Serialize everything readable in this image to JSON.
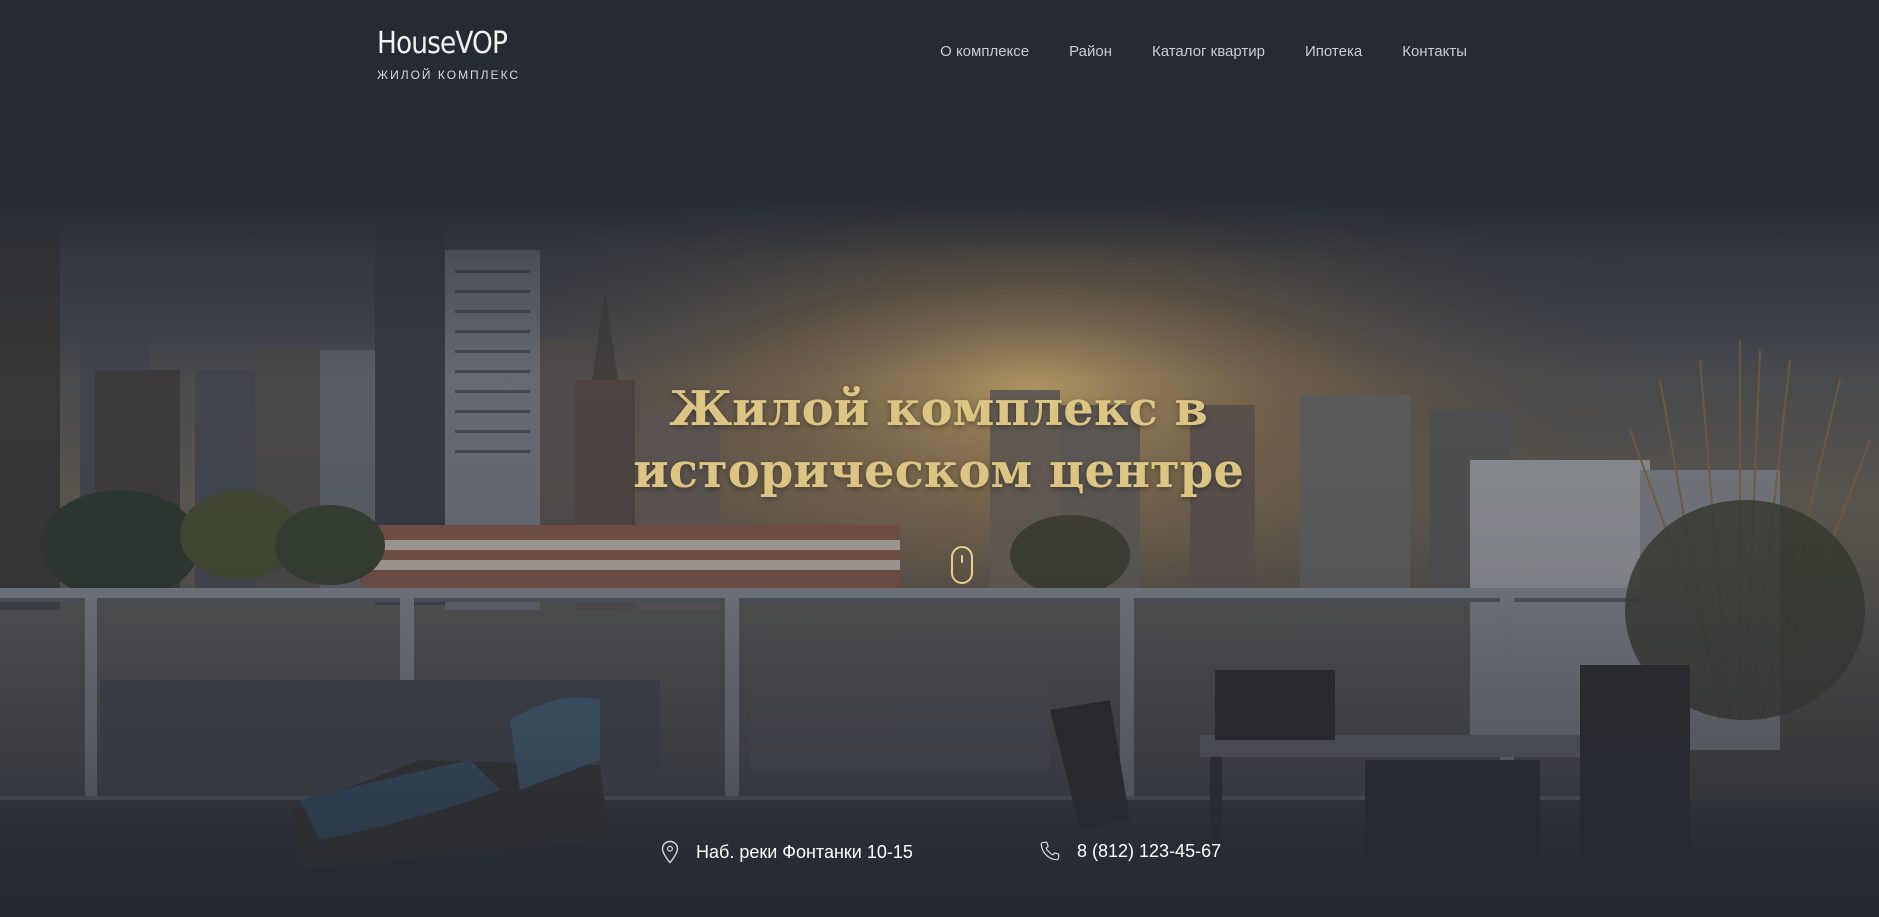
{
  "header": {
    "logo": {
      "title": "HouseVOP",
      "subtitle": "ЖИЛОЙ КОМПЛЕКС"
    },
    "nav": [
      {
        "label": "О комплексе"
      },
      {
        "label": "Район"
      },
      {
        "label": "Каталог квартир"
      },
      {
        "label": "Ипотека"
      },
      {
        "label": "Контакты"
      }
    ]
  },
  "hero": {
    "headline_line1": "Жилой комплекс в",
    "headline_line2": "историческом центре",
    "scroll_icon": "mouse-scroll-icon"
  },
  "contacts": {
    "address": {
      "icon": "map-pin-icon",
      "text": "Наб. реки Фонтанки 10-15"
    },
    "phone": {
      "icon": "phone-icon",
      "text": "8 (812) 123-45-67"
    }
  },
  "colors": {
    "background": "#252a33",
    "accent_gold": "#dcc583",
    "nav_text": "#c9ccd2",
    "contact_text": "#ffffff"
  }
}
